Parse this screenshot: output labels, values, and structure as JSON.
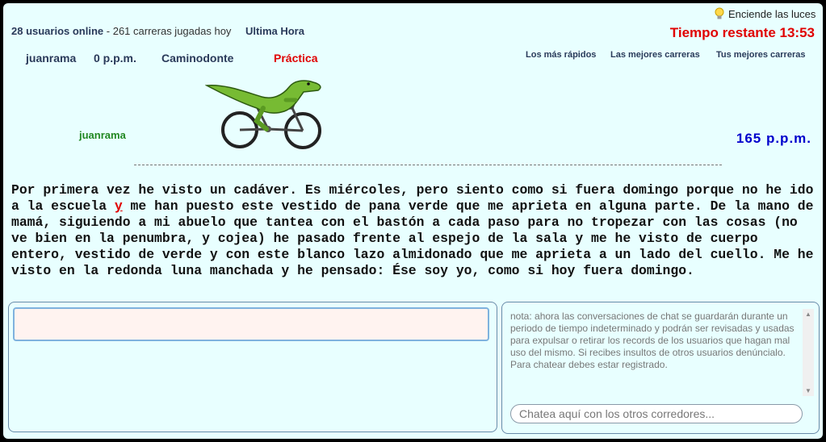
{
  "header": {
    "lights_label": "Enciende las luces",
    "online_users": "28 usuarios online",
    "races_today": "261 carreras jugadas hoy",
    "separator": " - ",
    "latest_news": "Ultima Hora",
    "time_remaining": "Tiempo restante 13:53"
  },
  "stats": {
    "username": "juanrama",
    "speed": "0 p.p.m.",
    "text_name": "Caminodonte",
    "mode": "Práctica"
  },
  "links": {
    "fastest": "Los más rápidos",
    "best_races": "Las mejores carreras",
    "my_best": "Tus mejores carreras"
  },
  "race": {
    "racer_name": "juanrama",
    "racer_speed": "165 p.p.m.",
    "text_before": "Por primera vez he visto un cadáver. Es miércoles, pero siento como si fuera domingo porque no he ido a la escuela ",
    "text_current": "y",
    "text_after": " me han puesto este vestido de pana verde que me aprieta en alguna parte. De la mano de mamá, siguiendo a mi abuelo que tantea con el bastón a cada paso para no tropezar con las cosas (no ve bien en la penumbra, y cojea) he pasado frente al espejo de la sala y me he visto de cuerpo entero, vestido de verde y con este blanco lazo almidonado que me aprieta a un lado del cuello. Me he visto en la redonda luna manchada y he pensado: Ése soy yo, como si hoy fuera domingo."
  },
  "typing": {
    "value": ""
  },
  "chat": {
    "note": "nota: ahora las conversaciones de chat se guardarán durante un periodo de tiempo indeterminado y podrán ser revisadas y usadas para expulsar o retirar los records de los usuarios que hagan mal uso del mismo. Si recibes insultos de otros usuarios denúncialo. Para chatear debes estar registrado.",
    "placeholder": "Chatea aquí con los otros corredores..."
  },
  "colors": {
    "background": "#e8ffff",
    "accent_red": "#e00000",
    "speed_blue": "#0000cc",
    "racer_green": "#228822"
  },
  "icons": {
    "lights": "lightbulb-icon",
    "racer": "dinosaur-bicycle-icon"
  }
}
